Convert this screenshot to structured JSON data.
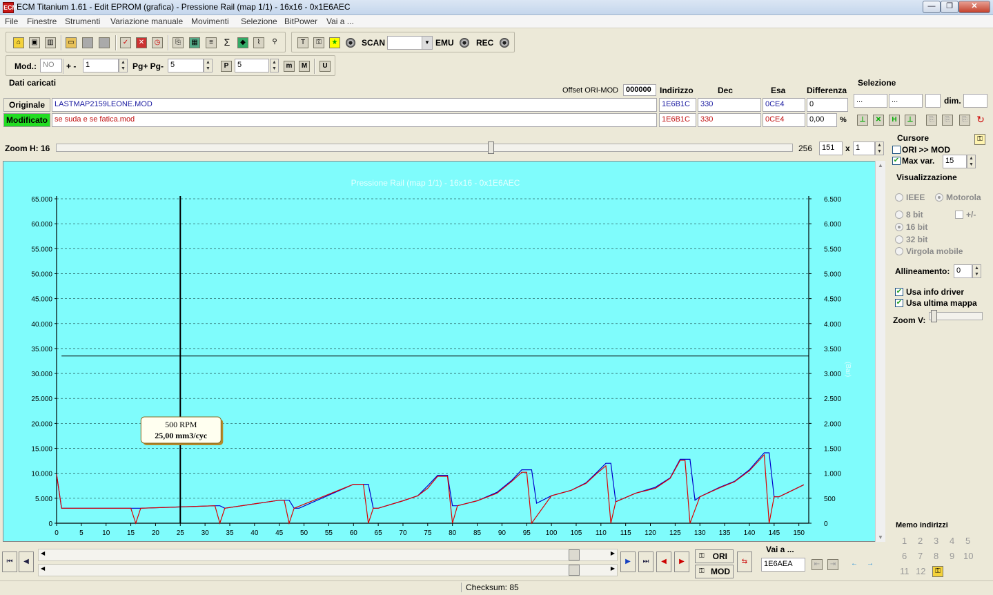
{
  "window": {
    "title": "ECM Titanium 1.61 - Edit EPROM (grafica) - Pressione Rail (map 1/1) - 16x16 - 0x1E6AEC",
    "icon_text": "ECM",
    "min_glyph": "—",
    "max_glyph": "❐",
    "close_glyph": "✕"
  },
  "menu": [
    "File",
    "Finestre",
    "Strumenti",
    "Variazione manuale",
    "Movimenti",
    "Selezione",
    "BitPower",
    "Vai a ..."
  ],
  "toolbar1": {
    "scan_label": "SCAN",
    "emu_label": "EMU",
    "rec_label": "REC",
    "scan_value": ""
  },
  "toolbar2": {
    "mod_label": "Mod.:",
    "mod_value": "NO",
    "plusminus_label": "+ -",
    "plusminus_value": "1",
    "pg_label": "Pg+ Pg-",
    "pg_value": "5",
    "p_value": "5",
    "p_icon": "P",
    "m_icon": "m",
    "M_icon": "M",
    "u_icon": "U"
  },
  "dati": {
    "title": "Dati caricati",
    "offset_label": "Offset ORI-MOD",
    "offset_value": "000000",
    "col_indirizzo": "Indirizzo",
    "col_dec": "Dec",
    "col_esa": "Esa",
    "col_differenza": "Differenza",
    "originale": {
      "label": "Originale",
      "file": "LASTMAP2159LEONE.MOD",
      "indirizzo": "1E6B1C",
      "dec": "330",
      "esa": "0CE4",
      "differenza": "0"
    },
    "modificato": {
      "label": "Modificato",
      "file": "se suda e se fatica.mod",
      "indirizzo": "1E6B1C",
      "dec": "330",
      "esa": "0CE4",
      "differenza": "0,00",
      "percent": "%"
    }
  },
  "selezione": {
    "title": "Selezione",
    "field1": "...",
    "field2": "...",
    "dim_label": "dim."
  },
  "zoom_h": {
    "label": "Zoom H: 16",
    "max": "256",
    "value": "151",
    "x_label": "x",
    "mult": "1",
    "level": 0.59
  },
  "cursore": {
    "title": "Cursore",
    "ori_mod_label": "ORI >> MOD",
    "max_var_label": "Max var.",
    "max_var_value": "15"
  },
  "visualizzazione": {
    "title": "Visualizzazione",
    "ieee": "IEEE",
    "motorola": "Motorola",
    "bit8": "8 bit",
    "plusminus": "+/-",
    "bit16": "16 bit",
    "bit32": "32 bit",
    "virgola": "Virgola mobile",
    "allineamento_label": "Allineamento:",
    "allineamento_value": "0",
    "usa_info_driver": "Usa info driver",
    "usa_ultima_mappa": "Usa ultima mappa",
    "zoom_v_label": "Zoom V:"
  },
  "memo": {
    "title": "Memo indirizzi",
    "numbers": [
      "1",
      "2",
      "3",
      "4",
      "5",
      "6",
      "7",
      "8",
      "9",
      "10",
      "11",
      "12"
    ]
  },
  "bottom": {
    "ori_label": "ORI",
    "mod_label": "MOD",
    "vai_label": "Vai a ...",
    "vai_value": "1E6AEA"
  },
  "status": {
    "checksum": "Checksum: 85"
  },
  "colors": {
    "chart_bg": "#7ffcfc",
    "original_line": "#0000cc",
    "modified_line": "#dd0000",
    "modificato_bg": "#22dd22"
  },
  "chart_data": {
    "type": "line",
    "title": "Pressione Rail (map 1/1) - 16x16 - 0x1E6AEC",
    "ylabel_right": "(Bar)",
    "xlim": [
      0,
      152
    ],
    "ylim_left": [
      0,
      65000
    ],
    "ylim_right": [
      0,
      6500
    ],
    "x_ticks": [
      0,
      5,
      10,
      15,
      20,
      25,
      30,
      35,
      40,
      45,
      50,
      55,
      60,
      65,
      70,
      75,
      80,
      85,
      90,
      95,
      100,
      105,
      110,
      115,
      120,
      125,
      130,
      135,
      140,
      145,
      150
    ],
    "y_ticks_left": [
      "0",
      "5.000",
      "10.000",
      "15.000",
      "20.000",
      "25.000",
      "30.000",
      "35.000",
      "40.000",
      "45.000",
      "50.000",
      "55.000",
      "60.000",
      "65.000"
    ],
    "y_ticks_right": [
      "0",
      "500",
      "1.000",
      "1.500",
      "2.000",
      "2.500",
      "3.000",
      "3.500",
      "4.000",
      "4.500",
      "5.000",
      "5.500",
      "6.000",
      "6.500"
    ],
    "grid": "horizontal dashed",
    "cursor_x": 25,
    "hline_y": 33500,
    "tooltip": {
      "line1": "500 RPM",
      "line2": "25,00 mm3/cyc"
    },
    "series": [
      {
        "color": "#0000cc",
        "x": [
          0,
          1,
          15,
          16,
          17,
          32,
          33,
          34,
          45,
          47,
          48,
          49,
          60,
          61,
          63,
          64,
          65,
          70,
          73,
          75,
          77,
          79,
          80,
          81,
          85,
          89,
          92,
          94,
          96,
          97,
          100,
          104,
          107,
          109,
          111,
          112,
          113,
          117,
          121,
          124,
          126,
          128,
          129,
          130,
          134,
          137,
          140,
          143,
          144,
          145,
          146,
          151
        ],
        "y": [
          9800,
          3000,
          3000,
          3000,
          3000,
          3500,
          3500,
          3000,
          4600,
          4600,
          3000,
          3000,
          7800,
          7800,
          7800,
          3000,
          3000,
          4500,
          5500,
          7500,
          9600,
          9600,
          3500,
          3500,
          4500,
          6200,
          8600,
          10700,
          10700,
          4000,
          5500,
          6600,
          8100,
          10000,
          12000,
          12000,
          4300,
          6000,
          7200,
          9100,
          12800,
          12800,
          4600,
          5300,
          7200,
          8400,
          10700,
          14100,
          14100,
          5300,
          5300,
          7700
        ]
      },
      {
        "color": "#dd0000",
        "x": [
          0,
          1,
          15,
          16,
          17,
          32,
          33,
          34,
          45,
          46,
          47,
          48,
          60,
          62,
          63,
          64,
          65,
          70,
          73,
          75,
          77,
          79,
          80,
          81,
          85,
          89,
          92,
          94,
          95,
          96,
          100,
          104,
          107,
          109,
          111,
          112,
          113,
          117,
          121,
          124,
          126,
          127,
          128,
          130,
          134,
          137,
          140,
          143,
          144,
          145,
          146,
          151
        ],
        "y": [
          9800,
          3000,
          3000,
          0,
          3000,
          3500,
          0,
          3000,
          4600,
          4600,
          0,
          3000,
          7800,
          7800,
          0,
          3000,
          3000,
          4500,
          5500,
          7000,
          9400,
          9400,
          0,
          3500,
          4500,
          6000,
          8400,
          10200,
          10200,
          0,
          5500,
          6600,
          8000,
          9800,
          11500,
          0,
          4300,
          6000,
          7000,
          9000,
          12600,
          12600,
          0,
          5300,
          7100,
          8300,
          10500,
          13700,
          0,
          5300,
          5300,
          7700
        ]
      }
    ]
  }
}
